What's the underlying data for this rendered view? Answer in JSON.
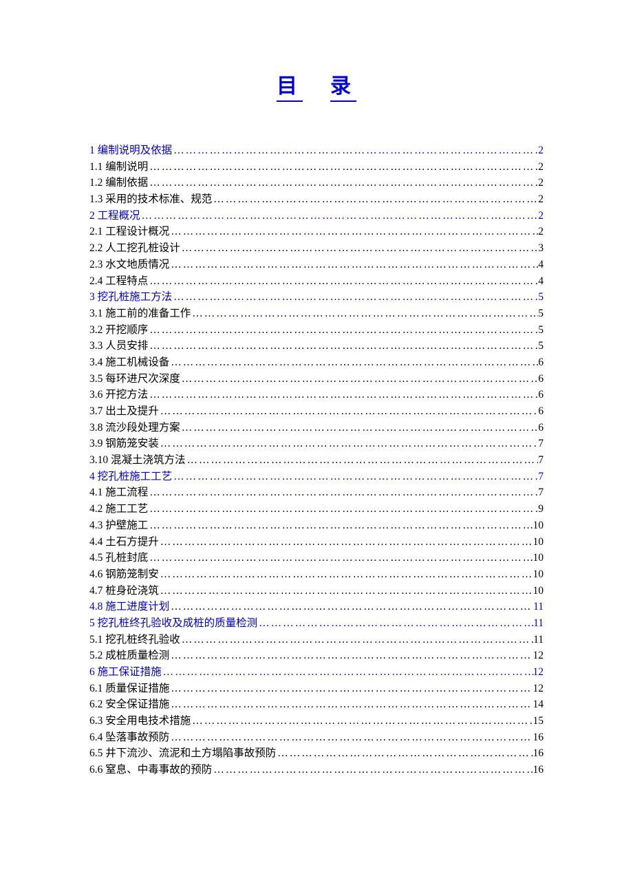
{
  "title_left": "目",
  "title_right": "录",
  "toc": [
    {
      "type": "section",
      "label": "1 编制说明及依据",
      "page": "2"
    },
    {
      "type": "sub",
      "label": "1.1  编制说明",
      "page": "2"
    },
    {
      "type": "sub",
      "label": "1.2  编制依据",
      "page": "2"
    },
    {
      "type": "sub",
      "label": "1.3  采用的技术标准、规范",
      "page": "2"
    },
    {
      "type": "section",
      "label": "2 工程概况",
      "page": "2"
    },
    {
      "type": "sub",
      "label": "2.1 工程设计概况",
      "page": "2"
    },
    {
      "type": "sub",
      "label": "2.2 人工挖孔桩设计",
      "page": "3"
    },
    {
      "type": "sub",
      "label": "2.3 水文地质情况",
      "page": "4"
    },
    {
      "type": "sub",
      "label": "2.4 工程特点",
      "page": "4"
    },
    {
      "type": "section",
      "label": "3 挖孔桩施工方法",
      "page": "5"
    },
    {
      "type": "sub",
      "label": "3.1 施工前的准备工作",
      "page": "5"
    },
    {
      "type": "sub",
      "label": "3.2 开挖顺序",
      "page": "5"
    },
    {
      "type": "sub",
      "label": "3.3 人员安排",
      "page": "5"
    },
    {
      "type": "sub",
      "label": "3.4 施工机械设备",
      "page": "6"
    },
    {
      "type": "sub",
      "label": "3.5 每环进尺次深度",
      "page": "6"
    },
    {
      "type": "sub",
      "label": "3.6 开挖方法",
      "page": "6"
    },
    {
      "type": "sub",
      "label": "3.7 出土及提升",
      "page": "6"
    },
    {
      "type": "sub",
      "label": "3.8 流沙段处理方案",
      "page": "6"
    },
    {
      "type": "sub",
      "label": "3.9 钢筋笼安装",
      "page": "7"
    },
    {
      "type": "sub",
      "label": "3.10 混凝土浇筑方法",
      "page": "7"
    },
    {
      "type": "section",
      "label": "4 挖孔桩施工工艺",
      "page": "7"
    },
    {
      "type": "sub",
      "label": "4.1 施工流程",
      "page": "7"
    },
    {
      "type": "sub",
      "label": "4.2 施工工艺",
      "page": "9"
    },
    {
      "type": "sub",
      "label": "4.3 护壁施工",
      "page": "10"
    },
    {
      "type": "sub",
      "label": "4.4 土石方提升",
      "page": "10"
    },
    {
      "type": "sub",
      "label": "4.5 孔桩封底",
      "page": "10"
    },
    {
      "type": "sub",
      "label": "4.6 钢筋笼制安",
      "page": "10"
    },
    {
      "type": "sub",
      "label": "4.7 桩身砼浇筑",
      "page": "10"
    },
    {
      "type": "special-sub",
      "label": "4.8 施工进度计划",
      "page": " 11"
    },
    {
      "type": "section",
      "label": "5 挖孔桩终孔验收及成桩的质量检测",
      "page": "11"
    },
    {
      "type": "sub",
      "label": "5.1 挖孔桩终孔验收",
      "page": "11"
    },
    {
      "type": "sub",
      "label": "5.2 成桩质量检测",
      "page": "12"
    },
    {
      "type": "section",
      "label": "6 施工保证措施",
      "page": "12"
    },
    {
      "type": "sub",
      "label": "6.1 质量保证措施",
      "page": "12"
    },
    {
      "type": "sub",
      "label": "6.2 安全保证措施",
      "page": "14"
    },
    {
      "type": "sub",
      "label": "6.3 安全用电技术措施",
      "page": "15"
    },
    {
      "type": "sub",
      "label": "6.4 坠落事故预防",
      "page": "16"
    },
    {
      "type": "sub",
      "label": "6.5 井下流沙、流泥和土方塌陷事故预防",
      "page": "16"
    },
    {
      "type": "sub",
      "label": "6.6 窒息、中毒事故的预防",
      "page": "16"
    }
  ]
}
